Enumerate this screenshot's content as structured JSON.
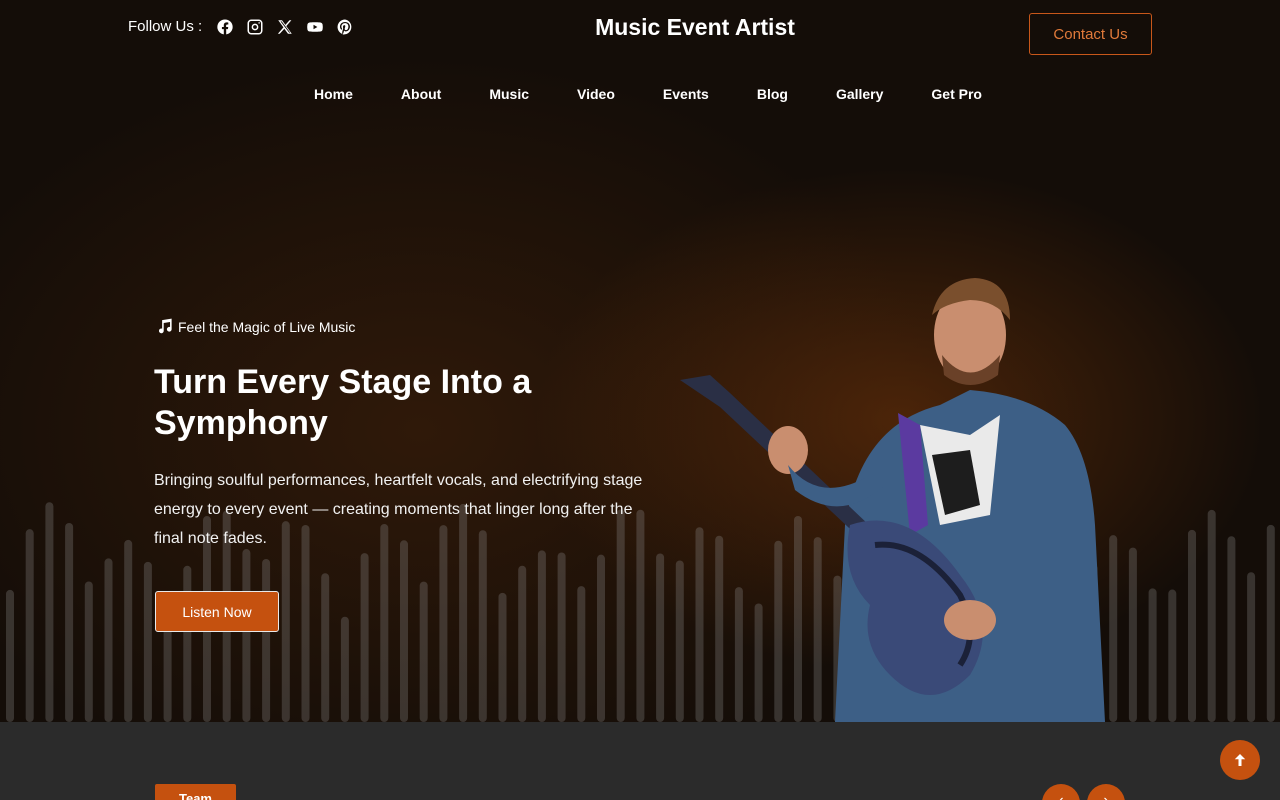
{
  "header": {
    "follow_label": "Follow Us :",
    "socials": [
      "facebook-icon",
      "instagram-icon",
      "x-icon",
      "youtube-icon",
      "pinterest-icon"
    ],
    "brand": "Music Event Artist",
    "contact_label": "Contact Us"
  },
  "nav": {
    "items": [
      "Home",
      "About",
      "Music",
      "Video",
      "Events",
      "Blog",
      "Gallery",
      "Get Pro"
    ]
  },
  "hero": {
    "tagline": "Feel the Magic of Live Music",
    "headline": "Turn Every Stage Into a Symphony",
    "description": "Bringing soulful performances, heartfelt vocals, and electrifying stage energy to every event — creating moments that linger long after the final note fades.",
    "cta_label": "Listen Now"
  },
  "section": {
    "badge": "Team",
    "prev_icon": "chevron-left-icon",
    "next_icon": "chevron-right-icon"
  },
  "colors": {
    "accent": "#c5510f",
    "background": "#140d08",
    "footer": "#2b2b2b"
  }
}
